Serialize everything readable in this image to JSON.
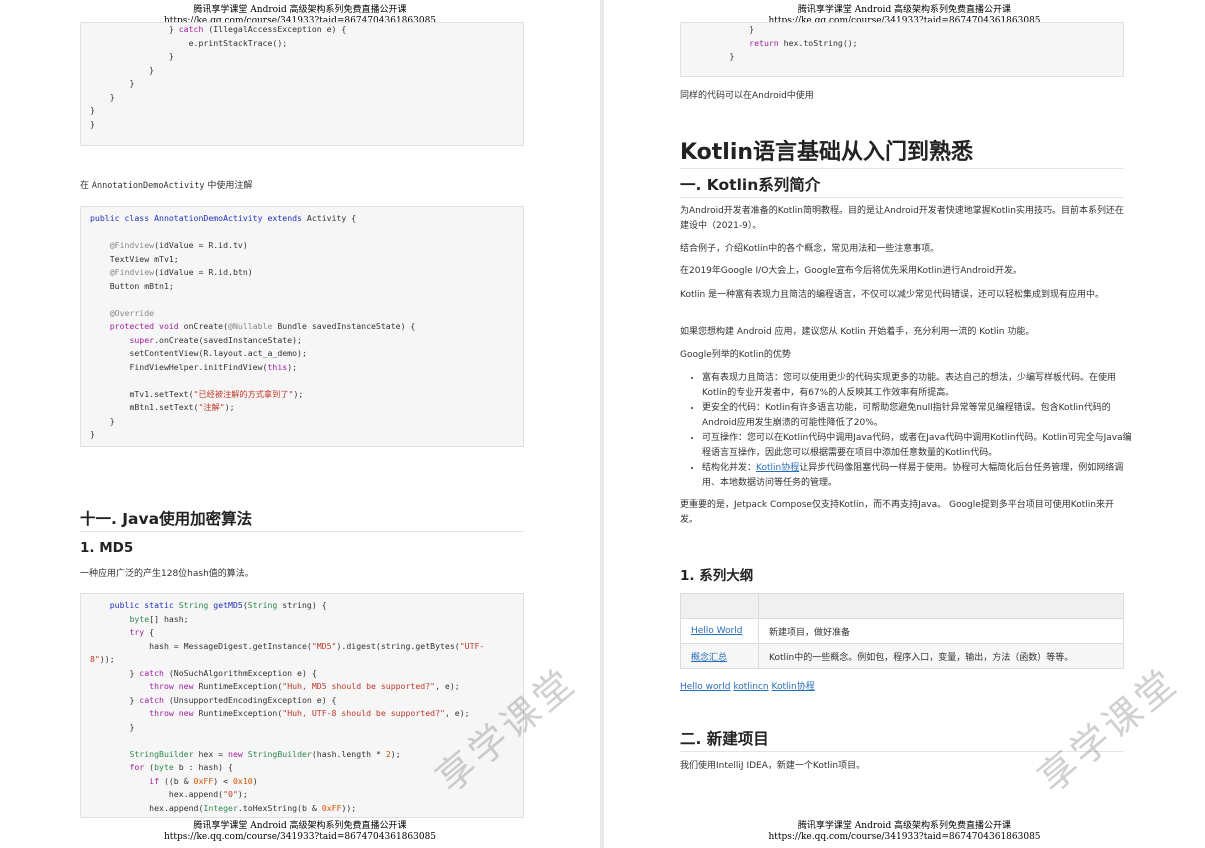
{
  "header": {
    "line1": "腾讯享学课堂 Android 高级架构系列免费直播公开课",
    "line2": "https://ke.qq.com/course/341933?taid=8674704361863085"
  },
  "watermark": "享学课堂",
  "left": {
    "intro_prefix": "在 ",
    "intro_code": "AnnotationDemoActivity",
    "intro_suffix": " 中使用注解",
    "h2_java": "十一. Java使用加密算法",
    "h3_md5": "1. MD5",
    "md5_desc": "一种应用广泛的产生128位hash值的算法。"
  },
  "right": {
    "same_code": "同样的代码可以在Android中使用",
    "title": "Kotlin语言基础从入门到熟悉",
    "h2_intro": "一. Kotlin系列简介",
    "p1": "为Android开发者准备的Kotlin简明教程。目的是让Android开发者快速地掌握Kotlin实用技巧。目前本系列还在建设中（2021-9）。",
    "p2": "结合例子，介绍Kotlin中的各个概念，常见用法和一些注意事项。",
    "p3": "在2019年Google I/O大会上，Google宣布今后将优先采用Kotlin进行Android开发。",
    "p4": "Kotlin 是一种富有表现力且简洁的编程语言，不仅可以减少常见代码错误，还可以轻松集成到现有应用中。",
    "p5": "如果您想构建 Android 应用，建议您从 Kotlin 开始着手，充分利用一流的 Kotlin 功能。",
    "p6": "Google列举的Kotlin的优势",
    "bullets": [
      "富有表现力且简洁：您可以使用更少的代码实现更多的功能。表达自己的想法，少编写样板代码。在使用Kotlin的专业开发者中，有67%的人反映其工作效率有所提高。",
      "更安全的代码：Kotlin有许多语言功能，可帮助您避免null指针异常等常见编程错误。包含Kotlin代码的Android应用发生崩溃的可能性降低了20%。",
      "可互操作：您可以在Kotlin代码中调用Java代码，或者在Java代码中调用Kotlin代码。Kotlin可完全与Java编程语言互操作，因此您可以根据需要在项目中添加任意数量的Kotlin代码。"
    ],
    "bullet4_prefix": "结构化并发：",
    "bullet4_link": "Kotlin协程",
    "bullet4_suffix": "让异步代码像阻塞代码一样易于使用。协程可大幅简化后台任务管理，例如网络调用、本地数据访问等任务的管理。",
    "p7": "更重要的是，Jetpack Compose仅支持Kotlin，而不再支持Java。 Google提到多平台项目可使用Kotlin来开发。",
    "h3_outline": "1. 系列大纲",
    "table": [
      {
        "link": "Hello World",
        "desc": "新建项目，做好准备"
      },
      {
        "link": "概念汇总",
        "desc": "Kotlin中的一些概念。例如包，程序入口，变量，输出，方法（函数）等等。"
      }
    ],
    "links": [
      " Hello world",
      " kotlincn",
      " Kotlin协程"
    ],
    "h2_new": "二. 新建项目",
    "p8": "我们使用IntelliJ IDEA，新建一个Kotlin项目。"
  }
}
